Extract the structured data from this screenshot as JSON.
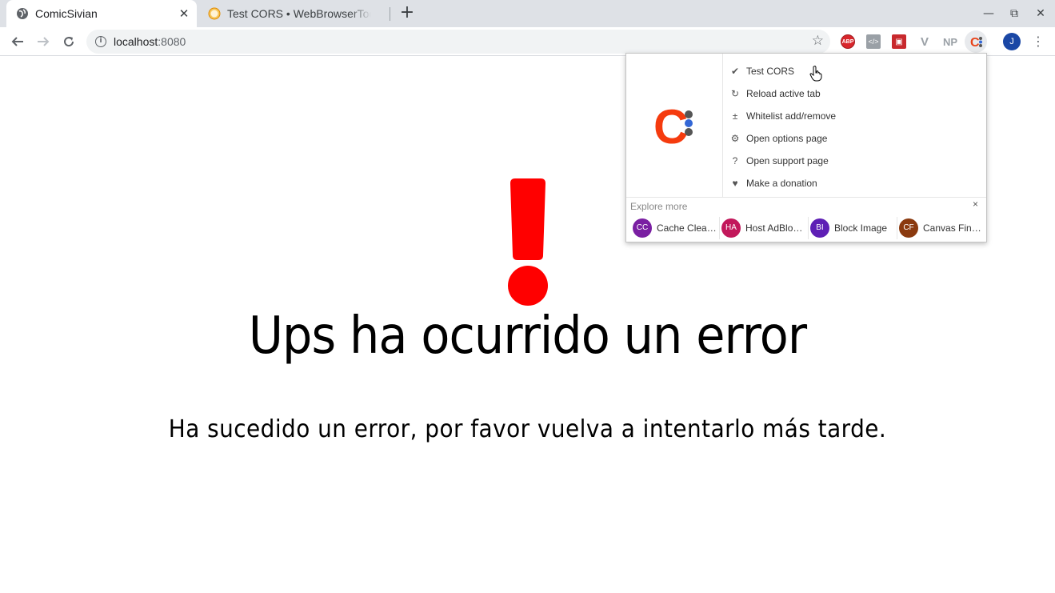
{
  "tabs": [
    {
      "title": "ComicSivian",
      "favicon": "globe-icon",
      "close": "✕"
    },
    {
      "title": "Test CORS • WebBrowserTools",
      "favicon": "cors-icon"
    }
  ],
  "new_tab": "+",
  "window_controls": {
    "minimize": "—",
    "restore": "⧉",
    "close": "✕"
  },
  "toolbar": {
    "url_host": "localhost",
    "url_port": ":8080",
    "extensions": [
      {
        "name": "abp-icon",
        "label": "ABP"
      },
      {
        "name": "code-icon",
        "label": "</>"
      },
      {
        "name": "red-ext-icon",
        "label": "▣"
      },
      {
        "name": "v-icon",
        "label": "V"
      },
      {
        "name": "np-icon",
        "label": "NP"
      },
      {
        "name": "cors-extension-icon",
        "label": "C:"
      }
    ],
    "avatar": "J"
  },
  "page": {
    "heading": "Ups ha ocurrido un error",
    "subheading": "Ha sucedido un error, por favor vuelva a intentarlo más tarde.",
    "accent_color": "#ff0000"
  },
  "popup": {
    "logo_letter": "C",
    "menu": [
      {
        "label": "Test CORS",
        "icon": "check-icon",
        "glyph": "✔"
      },
      {
        "label": "Reload active tab",
        "icon": "reload-icon",
        "glyph": "↻"
      },
      {
        "label": "Whitelist add/remove",
        "icon": "plus-minus-icon",
        "glyph": "±"
      },
      {
        "label": "Open options page",
        "icon": "gear-icon",
        "glyph": "⚙"
      },
      {
        "label": "Open support page",
        "icon": "question-icon",
        "glyph": "?"
      },
      {
        "label": "Make a donation",
        "icon": "heart-icon",
        "glyph": "♥"
      }
    ],
    "explore_label": "Explore more",
    "close": "×",
    "recommendations": [
      {
        "badge": "CC",
        "name": "Cache Cleaner",
        "color": "#7a1fa2"
      },
      {
        "badge": "HA",
        "name": "Host AdBlocker",
        "color": "#c2185b"
      },
      {
        "badge": "BI",
        "name": "Block Image",
        "color": "#5e1fb5"
      },
      {
        "badge": "CF",
        "name": "Canvas Fingerprint",
        "color": "#8b3a0f"
      }
    ]
  }
}
